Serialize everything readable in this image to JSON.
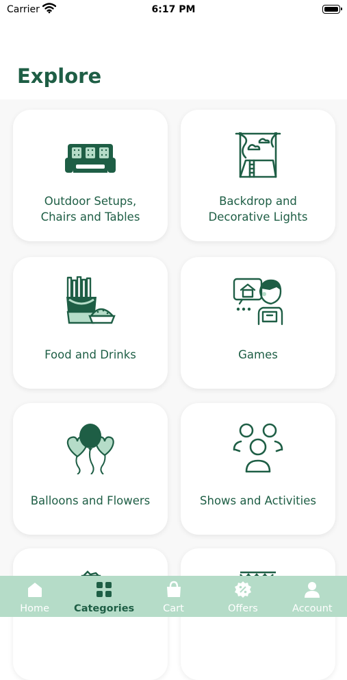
{
  "status_bar": {
    "carrier": "Carrier",
    "time": "6:17 PM"
  },
  "page": {
    "title": "Explore"
  },
  "categories": [
    {
      "line1": "Outdoor Setups,",
      "line2": "Chairs and Tables",
      "icon": "sofa-icon"
    },
    {
      "line1": "Backdrop and",
      "line2": "Decorative Lights",
      "icon": "backdrop-icon"
    },
    {
      "line1": "Food and Drinks",
      "icon": "food-drinks-icon"
    },
    {
      "line1": "Games",
      "icon": "games-icon"
    },
    {
      "line1": "Balloons and Flowers",
      "icon": "balloons-icon"
    },
    {
      "line1": "Shows and Activities",
      "icon": "people-group-icon"
    }
  ],
  "tabs": [
    {
      "label": "Home",
      "icon": "home-icon",
      "active": false
    },
    {
      "label": "Categories",
      "icon": "grid-icon",
      "active": true
    },
    {
      "label": "Cart",
      "icon": "bag-icon",
      "active": false
    },
    {
      "label": "Offers",
      "icon": "offer-badge-icon",
      "active": false
    },
    {
      "label": "Account",
      "icon": "person-icon",
      "active": false
    }
  ],
  "colors": {
    "primary": "#1e5e45",
    "accent_light": "#b5dcc8",
    "card_bg": "#ffffff",
    "tab_inactive": "#ffffff"
  }
}
